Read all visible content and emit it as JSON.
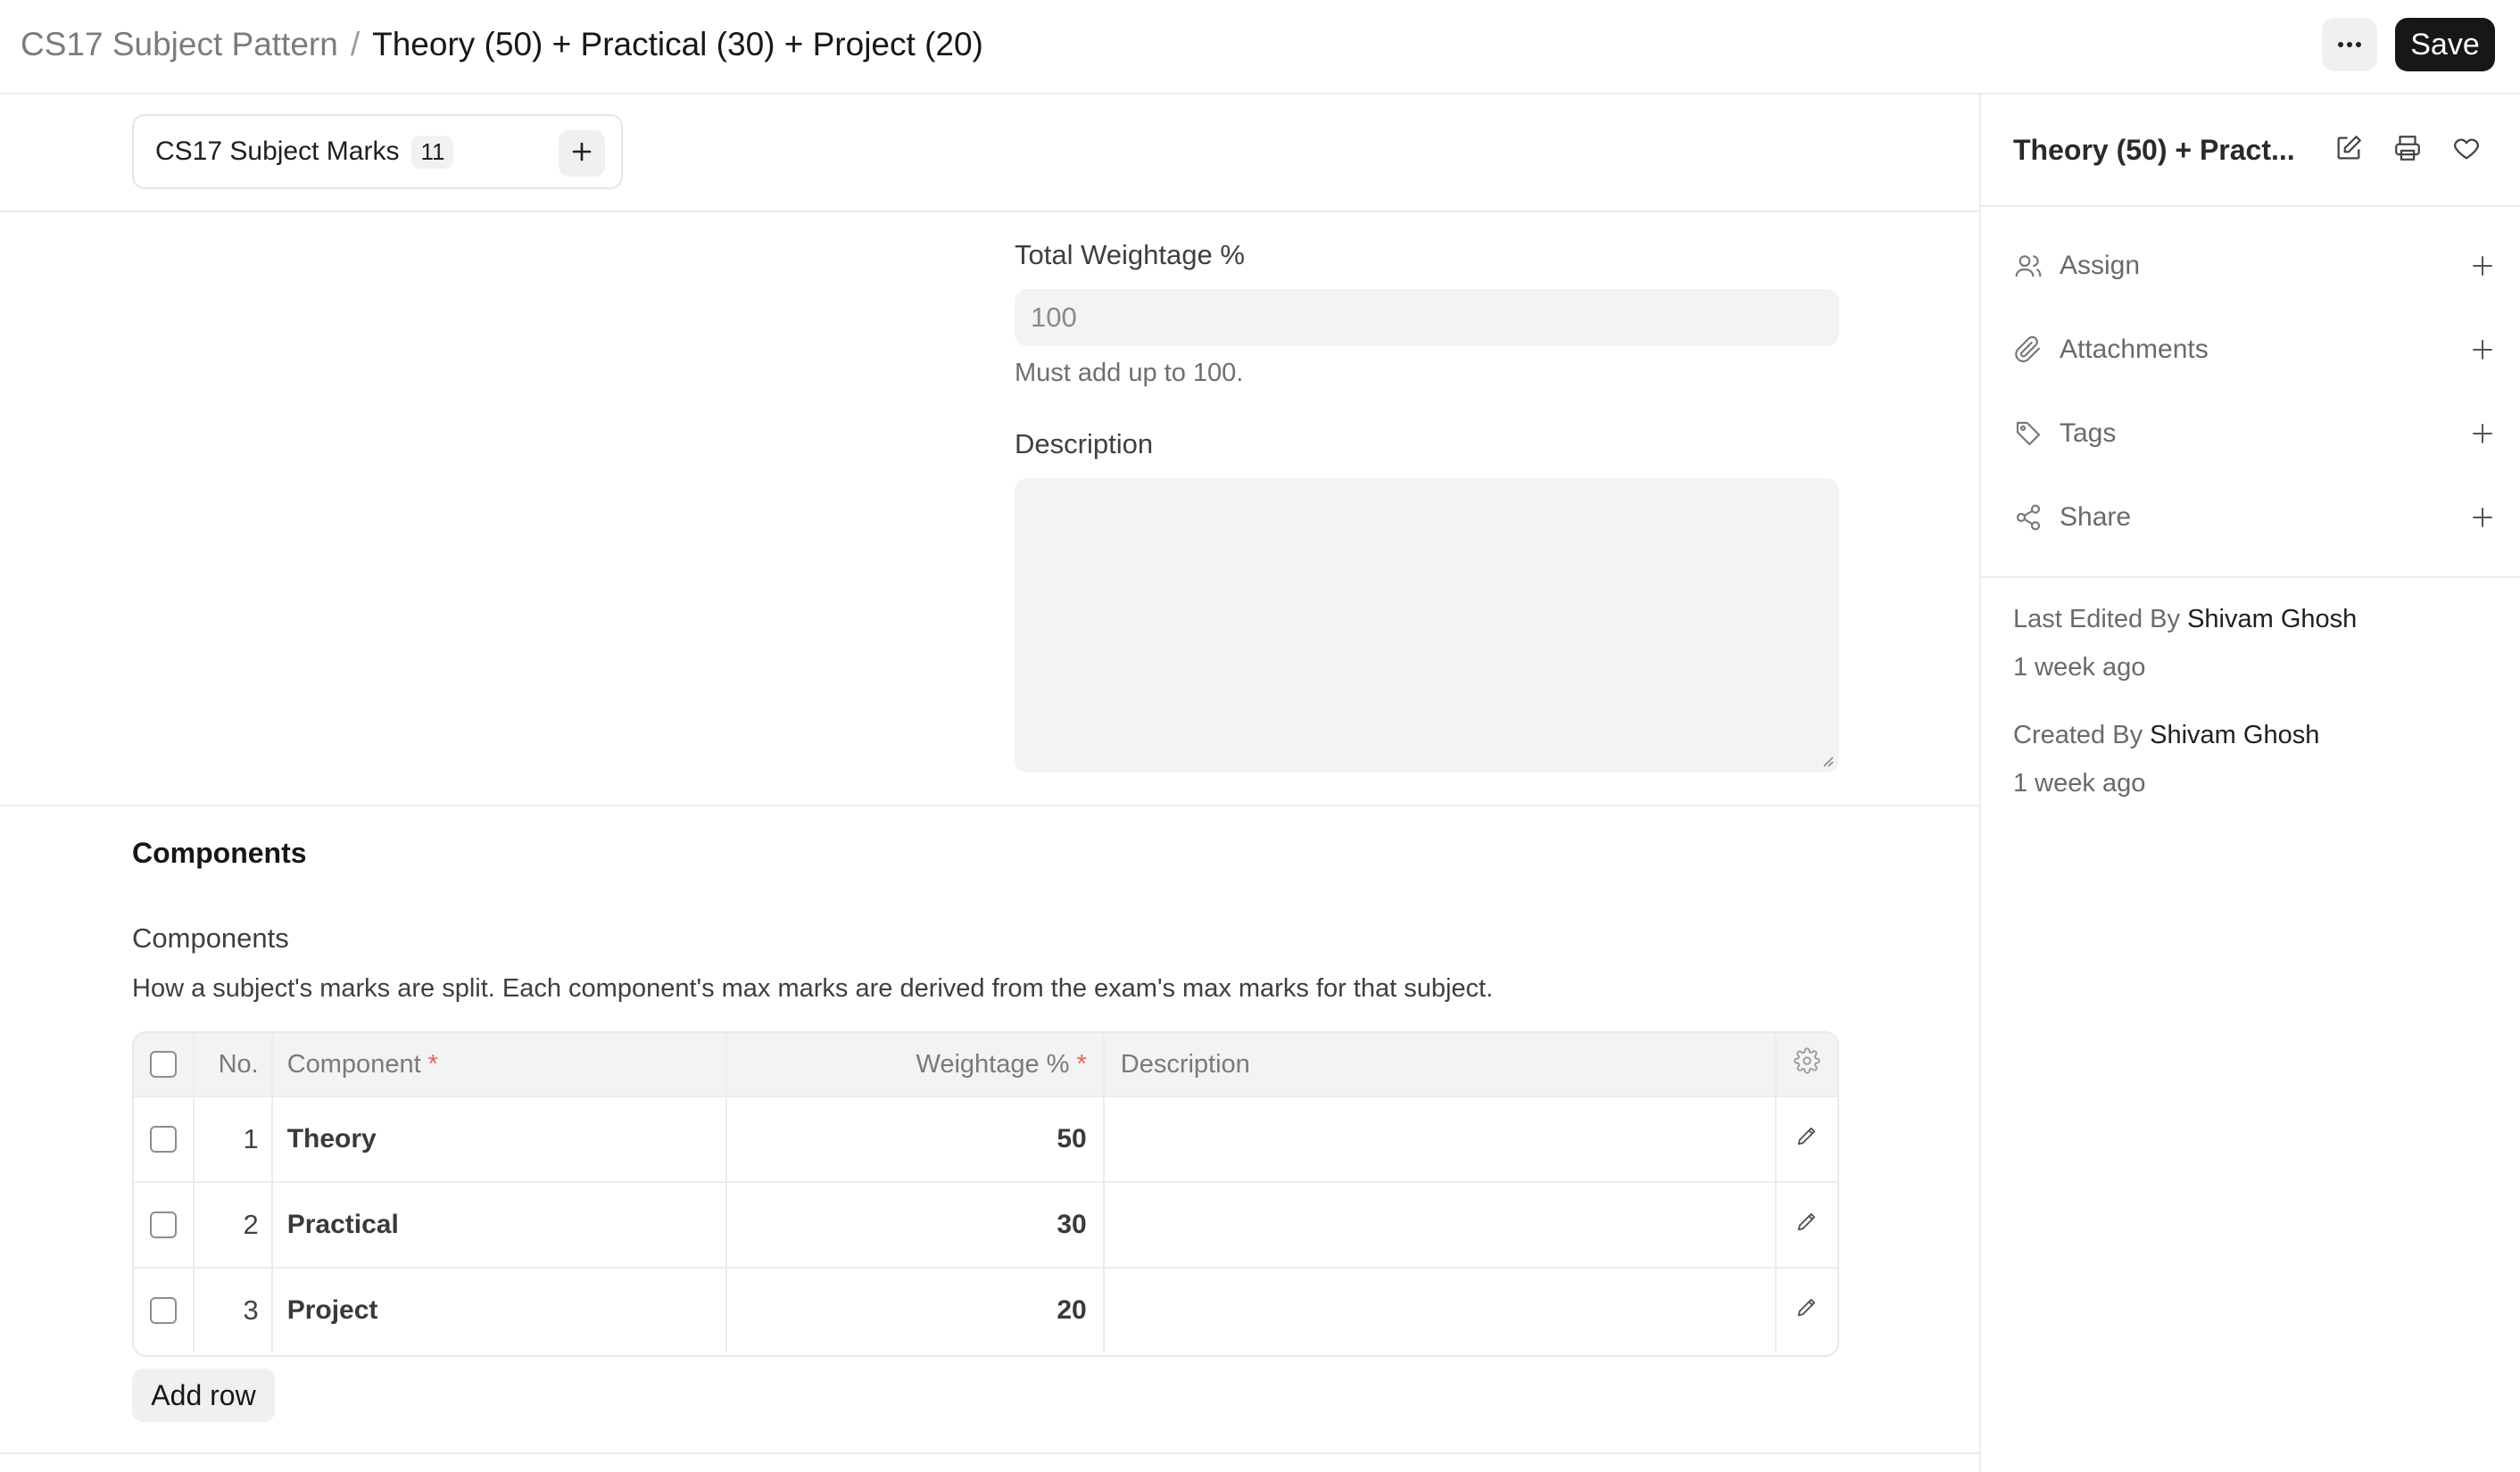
{
  "breadcrumb": {
    "parent": "CS17 Subject Pattern",
    "separator": "/",
    "current": "Theory (50) + Practical (30) + Project (20)"
  },
  "toolbar": {
    "more_icon": "ellipsis-icon",
    "save_label": "Save"
  },
  "connections": {
    "label": "CS17 Subject Marks",
    "count": "11"
  },
  "form": {
    "total_weightage_label": "Total Weightage %",
    "total_weightage_placeholder": "100",
    "total_weightage_help": "Must add up to 100.",
    "description_label": "Description"
  },
  "components_section": {
    "title": "Components",
    "table_label": "Components",
    "table_description": "How a subject's marks are split. Each component's max marks are derived from the exam's max marks for that subject.",
    "headers": {
      "no": "No.",
      "component": "Component",
      "weightage": "Weightage %",
      "description": "Description",
      "required_mark": "*"
    },
    "rows": [
      {
        "no": "1",
        "component": "Theory",
        "weightage": "50",
        "description": ""
      },
      {
        "no": "2",
        "component": "Practical",
        "weightage": "30",
        "description": ""
      },
      {
        "no": "3",
        "component": "Project",
        "weightage": "20",
        "description": ""
      }
    ],
    "add_row_label": "Add row"
  },
  "sidebar": {
    "title": "Theory (50) + Pract...",
    "items": [
      {
        "label": "Assign",
        "icon": "users-icon"
      },
      {
        "label": "Attachments",
        "icon": "paperclip-icon"
      },
      {
        "label": "Tags",
        "icon": "tag-icon"
      },
      {
        "label": "Share",
        "icon": "share-icon"
      }
    ],
    "last_edited_prefix": "Last Edited By",
    "last_edited_by": "Shivam Ghosh",
    "last_edited_time": "1 week ago",
    "created_prefix": "Created By",
    "created_by": "Shivam Ghosh",
    "created_time": "1 week ago"
  },
  "colors": {
    "primary_button": "#171717",
    "required_marker": "#e2665a",
    "input_background": "#f3f3f3"
  }
}
